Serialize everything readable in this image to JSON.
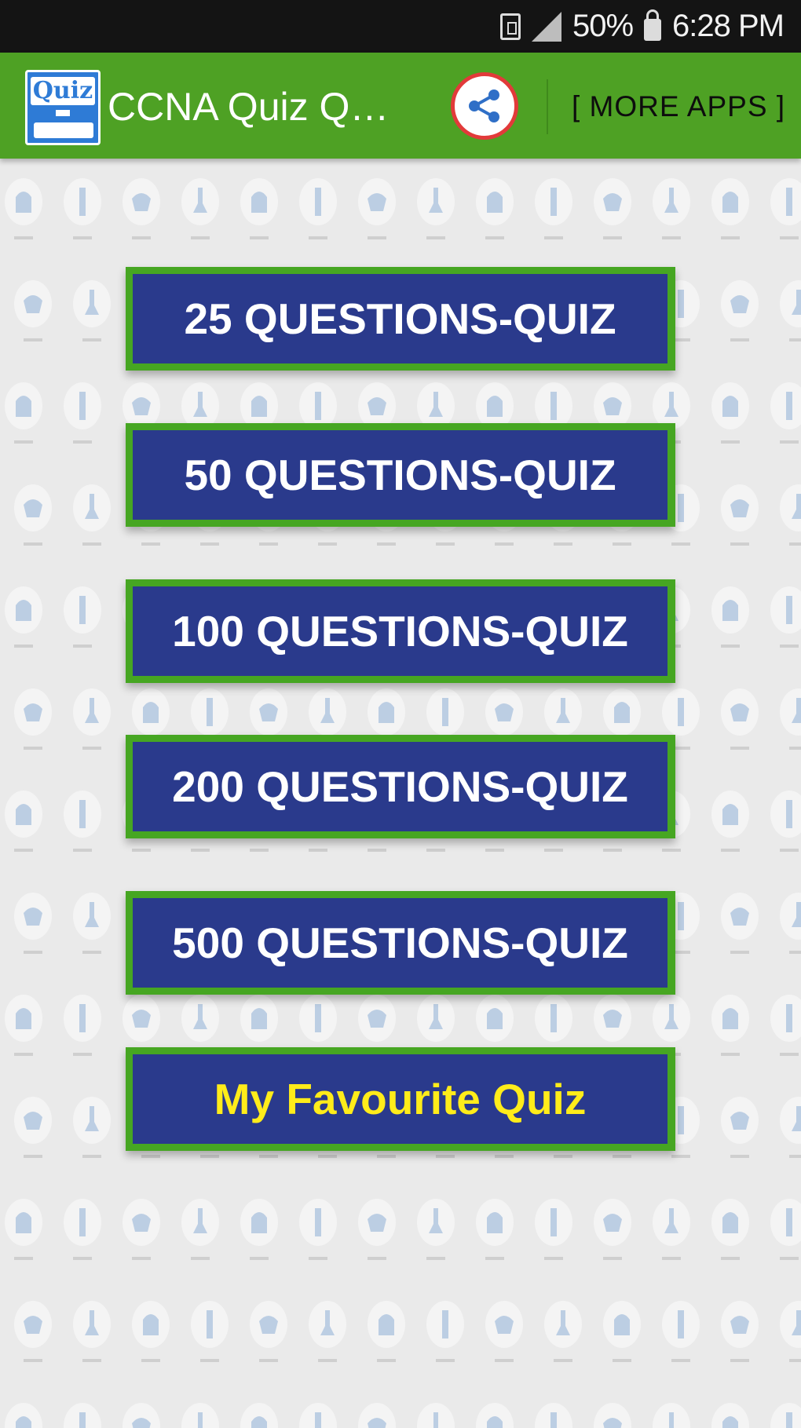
{
  "status_bar": {
    "battery": "50%",
    "time": "6:28 PM",
    "icons": [
      "sim-icon",
      "signal-icon",
      "lock-icon"
    ]
  },
  "app_bar": {
    "title": "CCNA Quiz Questions",
    "logo_text": "Quiz",
    "share_icon": "share-icon",
    "more_apps_label": "[ MORE APPS ]",
    "colors": {
      "bar": "#4ea124",
      "share_ring": "#e23a3a"
    }
  },
  "menu": {
    "items": [
      {
        "label": "25 QUESTIONS-QUIZ"
      },
      {
        "label": "50 QUESTIONS-QUIZ"
      },
      {
        "label": "100 QUESTIONS-QUIZ"
      },
      {
        "label": "200 QUESTIONS-QUIZ"
      },
      {
        "label": "500 QUESTIONS-QUIZ"
      },
      {
        "label": "My Favourite Quiz"
      }
    ],
    "colors": {
      "button_bg": "#2a3a8c",
      "button_border": "#46a622",
      "label": "#ffffff",
      "favourite_label": "#ffec1a"
    }
  }
}
